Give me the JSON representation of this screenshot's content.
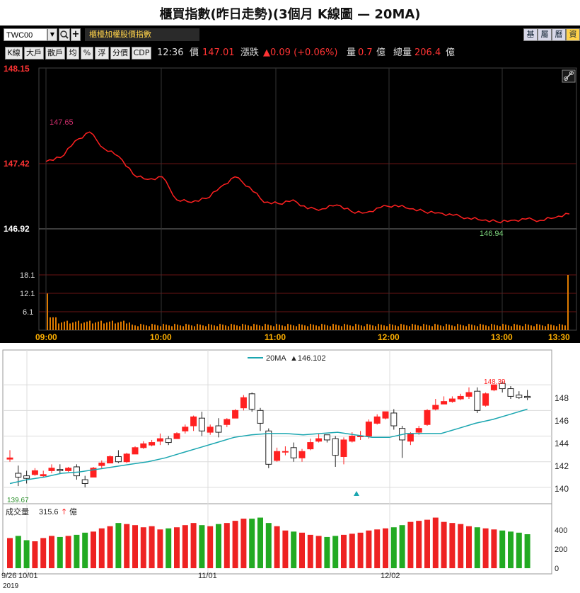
{
  "page_title": "櫃買指數(昨日走勢)(3個月 K線圖 — 20MA)",
  "toolbar": {
    "symbol_value": "TWC00",
    "index_name": "櫃檯加權股價指數",
    "right_buttons": [
      "基",
      "屬",
      "曆",
      "資"
    ],
    "tool_buttons": [
      "K線",
      "大戶",
      "散戶",
      "均",
      "%",
      "浮",
      "分價",
      "CDP"
    ]
  },
  "quote": {
    "time": "12:36",
    "price_label": "價",
    "price": "147.01",
    "change_label": "漲跌",
    "change": "▲0.09 (+0.06%)",
    "volume_label": "量",
    "volume": "0.7",
    "volume_unit": "億",
    "total_label": "總量",
    "total": "206.4",
    "total_unit": "億"
  },
  "intraday": {
    "y_ticks": [
      "148.15",
      "147.42",
      "146.92"
    ],
    "vol_ticks": [
      "18.1",
      "12.1",
      "6.1"
    ],
    "x_ticks": [
      "09:00",
      "10:00",
      "11:00",
      "12:00",
      "13:00",
      "13:30"
    ],
    "high_label": "147.65",
    "low_label": "146.94"
  },
  "kline": {
    "legend_name": "20MA",
    "legend_value": "▲146.102",
    "high_label": "148.39",
    "low_label": "139.67",
    "y_ticks": [
      "148",
      "146",
      "144",
      "142",
      "140"
    ],
    "volume_title": "成交量",
    "volume_value": "315.6",
    "volume_arrow": "↑",
    "volume_unit": "億",
    "volume_ticks": [
      "400",
      "200",
      "0"
    ],
    "x_ticks": [
      "9/26",
      "10/01",
      "11/01",
      "12/02"
    ],
    "year": "2019"
  },
  "colors": {
    "up": "#ff2020",
    "down": "#ffffff",
    "ma": "#1aa6b0",
    "vol_up": "#ee2222",
    "vol_down": "#22aa22"
  },
  "chart_data": [
    {
      "type": "line",
      "title": "",
      "x": [
        "09:00",
        "10:00",
        "11:00",
        "12:00",
        "13:00",
        "13:30"
      ],
      "series": [
        {
          "values": [
            147.42,
            147.35,
            147.2,
            147.11,
            146.96,
            147.01
          ]
        }
      ],
      "ylim": [
        146.7,
        148.15
      ],
      "volume_ticks_ylim": [
        0,
        18.1
      ]
    },
    {
      "type": "candlestick",
      "title": "",
      "x": [
        "9/26",
        "10/01",
        "11/01",
        "12/02"
      ],
      "ohlc": [
        [
          142.2,
          142.9,
          142.3,
          142.0
        ],
        [
          141.1,
          141.7,
          140.8,
          140.1
        ],
        [
          140.9,
          141.3,
          140.7,
          140.3
        ],
        [
          141.0,
          141.5,
          141.3,
          140.9
        ],
        [
          140.9,
          141.3,
          141.0,
          140.8
        ],
        [
          141.3,
          141.8,
          141.5,
          141.1
        ],
        [
          141.4,
          141.8,
          141.3,
          141.1
        ],
        [
          141.3,
          141.6,
          141.5,
          141.2
        ],
        [
          141.6,
          141.8,
          140.9,
          140.6
        ],
        [
          140.6,
          140.9,
          140.3,
          140.0
        ],
        [
          140.8,
          141.6,
          141.5,
          140.8
        ],
        [
          141.7,
          142.1,
          141.9,
          141.5
        ],
        [
          141.9,
          142.5,
          142.4,
          141.9
        ],
        [
          142.4,
          142.9,
          142.0,
          141.9
        ],
        [
          142.0,
          142.7,
          142.6,
          141.9
        ],
        [
          142.6,
          143.2,
          143.1,
          142.6
        ],
        [
          143.1,
          143.6,
          143.4,
          143.0
        ],
        [
          143.3,
          143.7,
          143.5,
          143.2
        ],
        [
          143.6,
          144.2,
          143.8,
          143.3
        ],
        [
          143.8,
          144.0,
          143.5,
          143.3
        ],
        [
          143.8,
          144.3,
          144.2,
          143.8
        ],
        [
          144.4,
          144.9,
          144.7,
          144.2
        ],
        [
          144.8,
          145.6,
          145.5,
          144.4
        ],
        [
          145.4,
          145.9,
          144.4,
          144.0
        ],
        [
          144.3,
          144.9,
          144.7,
          144.1
        ],
        [
          144.8,
          145.4,
          144.3,
          143.9
        ],
        [
          144.9,
          145.4,
          145.3,
          144.7
        ],
        [
          145.4,
          146.1,
          146.0,
          145.4
        ],
        [
          146.2,
          147.2,
          147.0,
          146.0
        ],
        [
          147.3,
          147.4,
          146.1,
          145.9
        ],
        [
          146.0,
          146.2,
          145.0,
          144.4
        ],
        [
          144.4,
          144.6,
          141.8,
          141.5
        ],
        [
          142.1,
          143.1,
          142.8,
          142.0
        ],
        [
          142.8,
          143.2,
          142.8,
          142.5
        ],
        [
          143.1,
          143.5,
          142.3,
          142.0
        ],
        [
          142.3,
          143.0,
          142.8,
          142.0
        ],
        [
          143.0,
          143.8,
          143.5,
          142.9
        ],
        [
          143.6,
          144.2,
          143.8,
          143.5
        ],
        [
          144.1,
          144.1,
          143.7,
          143.5
        ],
        [
          143.8,
          144.0,
          142.5,
          141.6
        ],
        [
          142.4,
          143.9,
          143.7,
          141.8
        ],
        [
          143.6,
          144.3,
          144.0,
          143.5
        ],
        [
          144.0,
          144.4,
          144.0,
          143.7
        ],
        [
          144.0,
          145.3,
          145.1,
          143.8
        ],
        [
          145.0,
          145.7,
          145.5,
          144.9
        ],
        [
          145.4,
          145.9,
          145.9,
          145.3
        ],
        [
          145.8,
          146.1,
          144.8,
          144.5
        ],
        [
          144.6,
          144.8,
          143.7,
          142.3
        ],
        [
          143.6,
          144.3,
          144.2,
          143.3
        ],
        [
          144.3,
          144.8,
          144.6,
          144.1
        ],
        [
          144.9,
          146.1,
          146.0,
          144.8
        ],
        [
          146.1,
          146.9,
          146.4,
          146.0
        ],
        [
          146.5,
          147.1,
          146.7,
          146.5
        ],
        [
          146.7,
          147.1,
          146.9,
          146.6
        ],
        [
          146.9,
          147.3,
          147.1,
          146.8
        ],
        [
          147.1,
          147.8,
          147.4,
          146.9
        ],
        [
          147.5,
          147.8,
          146.0,
          145.8
        ],
        [
          146.4,
          147.4,
          147.3,
          146.3
        ],
        [
          147.6,
          148.0,
          148.0,
          147.5
        ],
        [
          148.1,
          148.3,
          147.7,
          147.4
        ],
        [
          147.7,
          147.9,
          147.1,
          146.9
        ],
        [
          147.2,
          147.5,
          147.0,
          146.9
        ],
        [
          147.1,
          147.6,
          147.0,
          146.8
        ]
      ],
      "ma20": [
        140.3,
        140.6,
        140.8,
        141.1,
        141.2,
        141.4,
        141.6,
        141.8,
        142.0,
        142.3,
        142.7,
        143.1,
        143.5,
        143.9,
        144.1,
        144.2,
        144.2,
        144.1,
        144.2,
        144.3,
        144.1,
        143.9,
        143.9,
        144.2,
        144.2,
        144.2,
        144.6,
        145.0,
        145.3,
        145.7,
        146.1
      ],
      "volume": [
        280,
        300,
        260,
        250,
        280,
        300,
        290,
        300,
        310,
        330,
        340,
        370,
        390,
        420,
        410,
        400,
        380,
        390,
        360,
        370,
        380,
        400,
        420,
        400,
        390,
        410,
        420,
        440,
        460,
        460,
        470,
        420,
        390,
        350,
        340,
        330,
        310,
        300,
        290,
        300,
        310,
        320,
        330,
        350,
        360,
        370,
        380,
        400,
        430,
        440,
        450,
        470,
        430,
        420,
        410,
        390,
        380,
        370,
        360,
        350,
        340,
        330,
        315.6
      ],
      "ylim": [
        139,
        149.5
      ],
      "volume_ylim": [
        0,
        500
      ]
    }
  ]
}
